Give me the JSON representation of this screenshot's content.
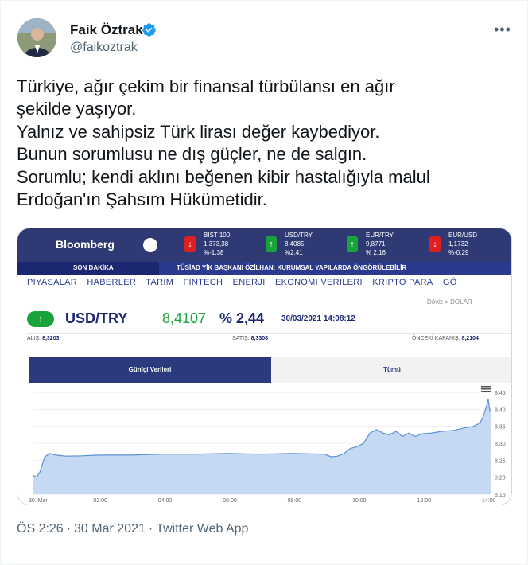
{
  "tweet": {
    "display_name": "Faik Öztrak",
    "handle": "@faikoztrak",
    "more_icon": "more-horizontal-icon",
    "verified_icon": "verified-badge-icon",
    "text": "Türkiye, ağır çekim bir finansal türbülansı en ağır\nşekilde yaşıyor.\nYalnız ve sahipsiz Türk lirası değer kaybediyor.\nBunun sorumlusu ne dış güçler, ne de salgın.\nSorumlu; kendi aklını beğenen kibir hastalığıyla malul\nErdoğan'ın Şahsım Hükümetidir.",
    "time": "ÖS 2:26",
    "date": "30 Mar 2021",
    "source": "Twitter Web App"
  },
  "media": {
    "brand": "Bloomberg",
    "tickers": [
      {
        "name": "BIST 100",
        "value": "1.373,38",
        "change": "%-1,38",
        "direction": "down"
      },
      {
        "name": "USD/TRY",
        "value": "8,4085",
        "change": "%2,41",
        "direction": "up"
      },
      {
        "name": "EUR/TRY",
        "value": "9,8771",
        "change": "% 2,16",
        "direction": "up"
      },
      {
        "name": "EUR/USD",
        "value": "1,1732",
        "change": "%-0,29",
        "direction": "down"
      }
    ],
    "breaking_label": "SON DAKİKA",
    "breaking_news": "TÜSİAD YİK BAŞKANI ÖZİLHAN: KURUMSAL YAPILARDA ÖNGÖRÜLEBİLİR",
    "nav": [
      "PIYASALAR",
      "HABERLER",
      "TARIM",
      "FINTECH",
      "ENERJI",
      "EKONOMI VERILERI",
      "KRIPTO PARA",
      "GÖ"
    ],
    "breadcrumb": "Döviz  >  DOLAR",
    "symbol": "USD/TRY",
    "price": "8,4107",
    "change_pct": "% 2,44",
    "timestamp": "30/03/2021 14:08:12",
    "bid_label": "ALIŞ:",
    "bid": "8,3203",
    "ask_label": "SATIŞ:",
    "ask": "8,3308",
    "prev_close_label": "ÖNCEKİ KAPANIŞ:",
    "prev_close": "8,2104",
    "tab_active": "Günîçi Verileri",
    "tab_inactive": "Tümü",
    "colors": {
      "brand_bar": "#2f3a75",
      "up": "#1aa33a",
      "down": "#e02020",
      "area": "#bcd2f0"
    }
  },
  "chart_data": {
    "type": "area",
    "x_ticks": [
      "30. Mar",
      "02:00",
      "04:00",
      "06:00",
      "08:00",
      "10:00",
      "12:00",
      "14:00"
    ],
    "y_ticks": [
      8.15,
      8.2,
      8.25,
      8.3,
      8.35,
      8.4,
      8.45
    ],
    "ylim": [
      8.15,
      8.45
    ],
    "xlim": [
      0,
      14.15
    ],
    "x": [
      0,
      0.1,
      0.2,
      0.35,
      0.5,
      0.7,
      1,
      1.5,
      2,
      3,
      4,
      5,
      6,
      7,
      8,
      9,
      9.2,
      9.4,
      9.6,
      9.8,
      10,
      10.2,
      10.4,
      10.6,
      10.8,
      11,
      11.2,
      11.4,
      11.6,
      11.8,
      12,
      12.3,
      12.6,
      13,
      13.3,
      13.6,
      13.8,
      13.9,
      14,
      14.05,
      14.1,
      14.15
    ],
    "y": [
      8.205,
      8.2,
      8.215,
      8.26,
      8.27,
      8.265,
      8.262,
      8.263,
      8.265,
      8.265,
      8.268,
      8.268,
      8.27,
      8.268,
      8.27,
      8.268,
      8.26,
      8.262,
      8.27,
      8.285,
      8.29,
      8.3,
      8.33,
      8.34,
      8.33,
      8.325,
      8.335,
      8.32,
      8.33,
      8.32,
      8.328,
      8.33,
      8.335,
      8.338,
      8.345,
      8.35,
      8.36,
      8.38,
      8.41,
      8.43,
      8.395,
      8.4
    ]
  }
}
